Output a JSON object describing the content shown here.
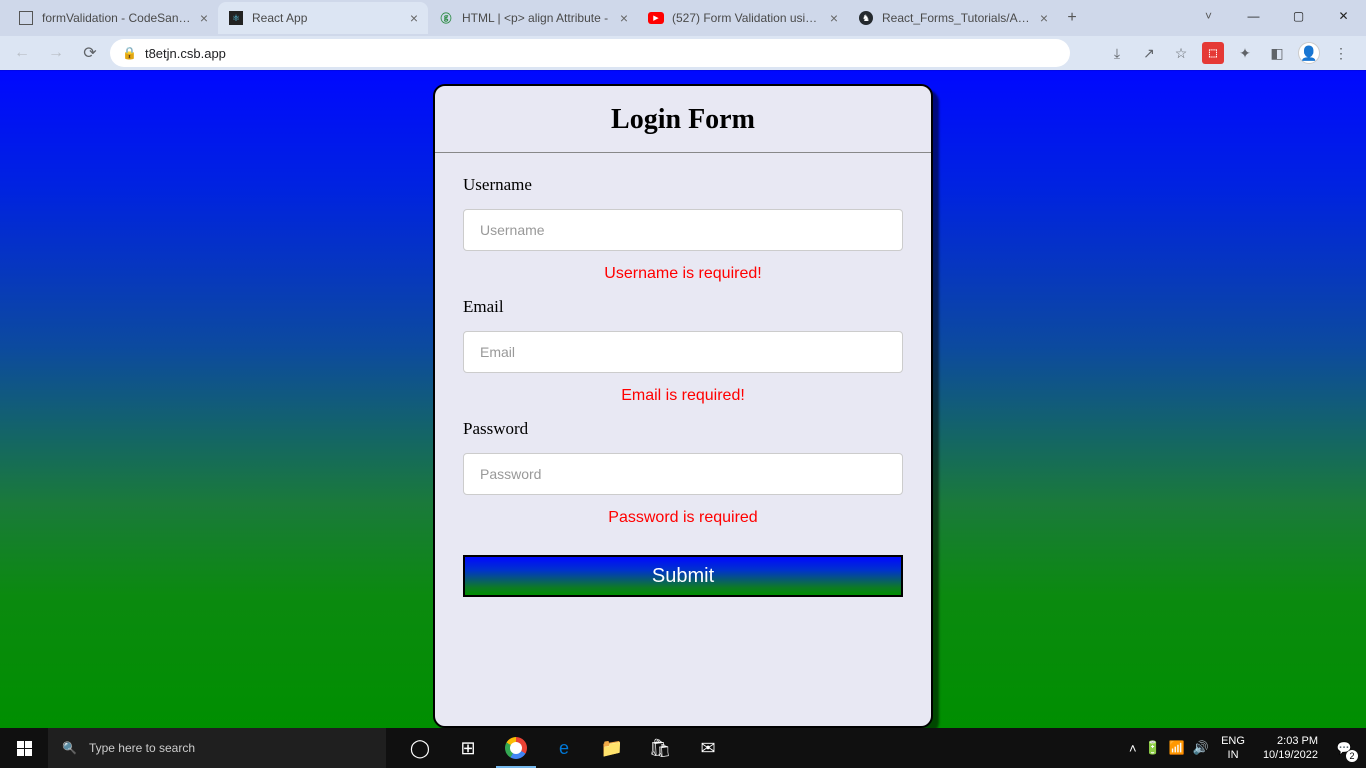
{
  "browser": {
    "tabs": [
      {
        "title": "formValidation - CodeSandbox",
        "active": false
      },
      {
        "title": "React App",
        "active": true
      },
      {
        "title": "HTML | <p> align Attribute - ",
        "active": false
      },
      {
        "title": "(527) Form Validation using R",
        "active": false
      },
      {
        "title": "React_Forms_Tutorials/App.js",
        "active": false
      }
    ],
    "url": "t8etjn.csb.app"
  },
  "form": {
    "title": "Login Form",
    "username": {
      "label": "Username",
      "placeholder": "Username",
      "value": "",
      "error": "Username is required!"
    },
    "email": {
      "label": "Email",
      "placeholder": "Email",
      "value": "",
      "error": "Email is required!"
    },
    "password": {
      "label": "Password",
      "placeholder": "Password",
      "value": "",
      "error": "Password is required"
    },
    "submit_label": "Submit"
  },
  "taskbar": {
    "search_placeholder": "Type here to search",
    "lang_top": "ENG",
    "lang_bottom": "IN",
    "time": "2:03 PM",
    "date": "10/19/2022",
    "notif_count": "2"
  }
}
